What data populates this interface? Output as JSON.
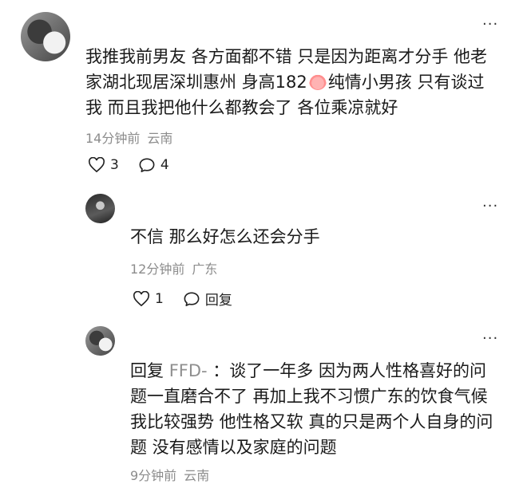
{
  "comments": [
    {
      "lines": [
        "我推我前男友 各方面都不错 只是因为距离才分手 他老",
        "家湖北现居深圳惠州 身高182",
        "纯情小男孩 只有谈过",
        "我 而且我把他什么都教会了 各位乘凉就好"
      ],
      "time": "14分钟前",
      "location": "云南",
      "likes": "3",
      "replies": "4"
    },
    {
      "text": "不信 那么好怎么还会分手",
      "time": "12分钟前",
      "location": "广东",
      "likes": "1",
      "reply_label": "回复"
    },
    {
      "reply_prefix": "回复 ",
      "reply_to": "FFD- ",
      "lines": [
        "：谈了一年多 因为两人性格喜好的问",
        "题一直磨合不了 再加上我不习惯广东的饮食气候",
        "我比较强势 他性格又软 真的只是两个人自身的问",
        "题 没有感情以及家庭的问题"
      ],
      "time": "9分钟前",
      "location": "云南"
    }
  ],
  "more_label": "···"
}
